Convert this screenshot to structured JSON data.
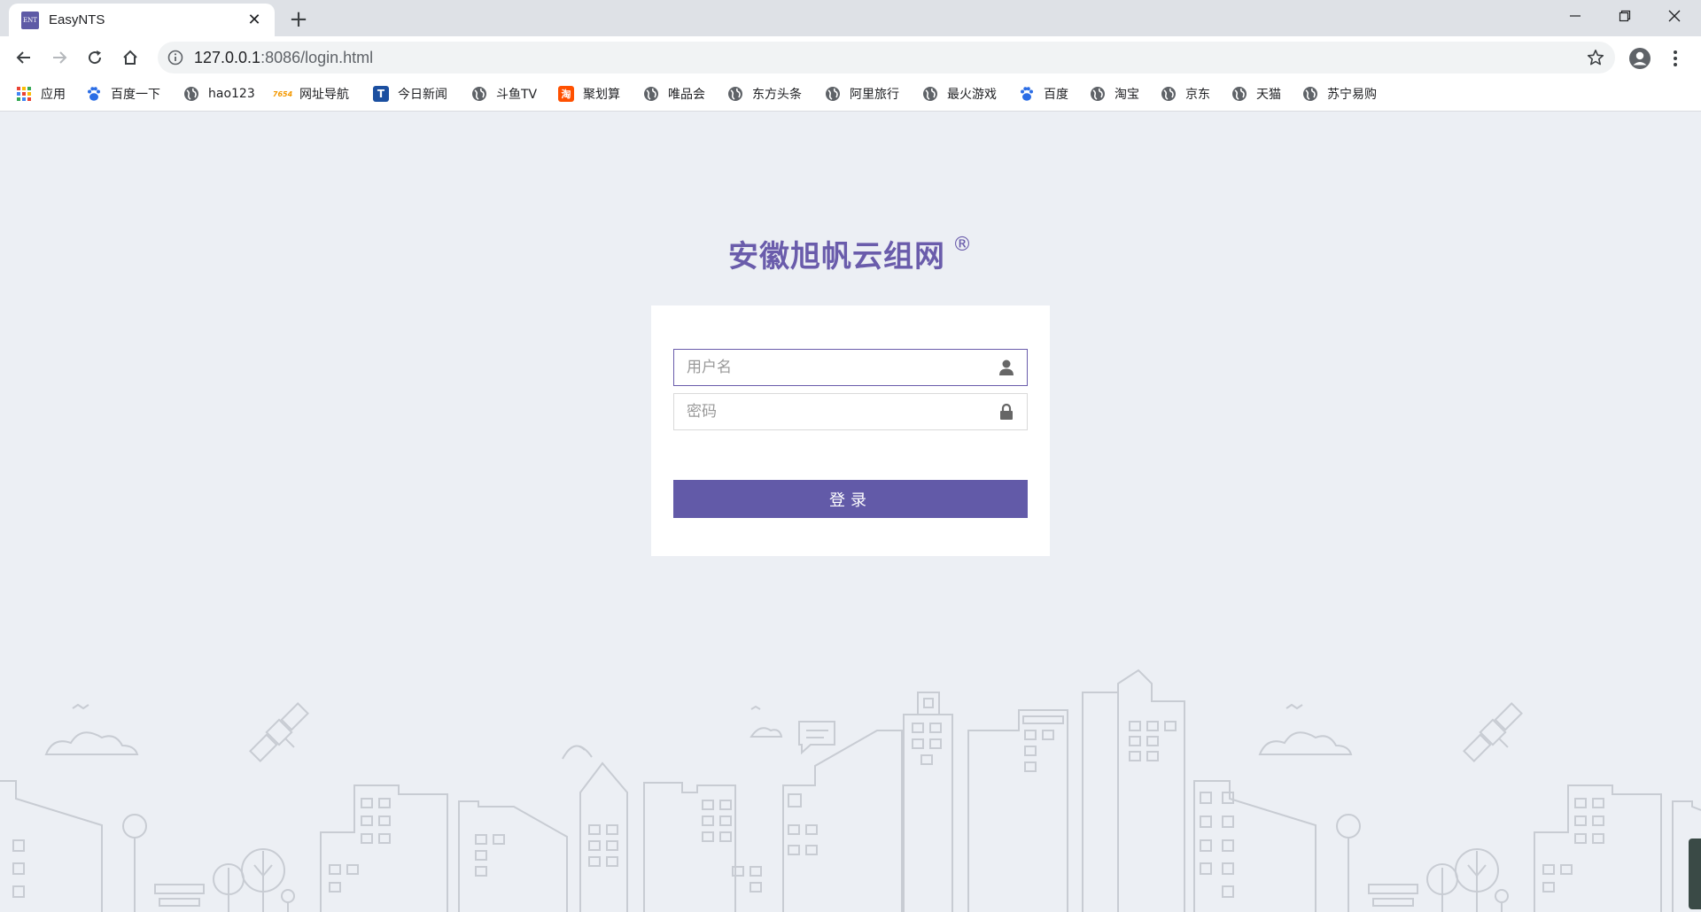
{
  "browser": {
    "tab": {
      "favicon_text": "ENT",
      "title": "EasyNTS",
      "close_glyph": "✕"
    },
    "new_tab_glyph": "+",
    "url": {
      "host": "127.0.0.1",
      "rest": ":8086/login.html"
    },
    "icons": [
      "back-icon",
      "forward-icon",
      "reload-icon",
      "home-icon",
      "info-icon",
      "star-icon",
      "profile-icon",
      "menu-icon",
      "minimize-icon",
      "maximize-icon",
      "close-icon"
    ]
  },
  "bookmarks": [
    {
      "label": "应用",
      "icon": "apps-grid-icon"
    },
    {
      "label": "百度一下",
      "icon": "baidu-paw-icon"
    },
    {
      "label": "hao123",
      "icon": "globe-icon"
    },
    {
      "label": "网址导航",
      "icon": "7654-icon"
    },
    {
      "label": "今日新闻",
      "icon": "news-t-icon"
    },
    {
      "label": "斗鱼TV",
      "icon": "globe-icon"
    },
    {
      "label": "聚划算",
      "icon": "taobao-tao-icon"
    },
    {
      "label": "唯品会",
      "icon": "globe-icon"
    },
    {
      "label": "东方头条",
      "icon": "globe-icon"
    },
    {
      "label": "阿里旅行",
      "icon": "globe-icon"
    },
    {
      "label": "最火游戏",
      "icon": "globe-icon"
    },
    {
      "label": "百度",
      "icon": "baidu-paw-icon"
    },
    {
      "label": "淘宝",
      "icon": "globe-icon"
    },
    {
      "label": "京东",
      "icon": "globe-icon"
    },
    {
      "label": "天猫",
      "icon": "globe-icon"
    },
    {
      "label": "苏宁易购",
      "icon": "globe-icon"
    }
  ],
  "login": {
    "brand": "安徽旭帆云组网",
    "registered_mark": "®",
    "username_placeholder": "用户名",
    "password_placeholder": "密码",
    "submit_label": "登录"
  },
  "colors": {
    "accent": "#625aa8",
    "brand_text": "#6a5cab",
    "page_bg": "#eceff4",
    "skyline_stroke": "#c8ccd3"
  }
}
